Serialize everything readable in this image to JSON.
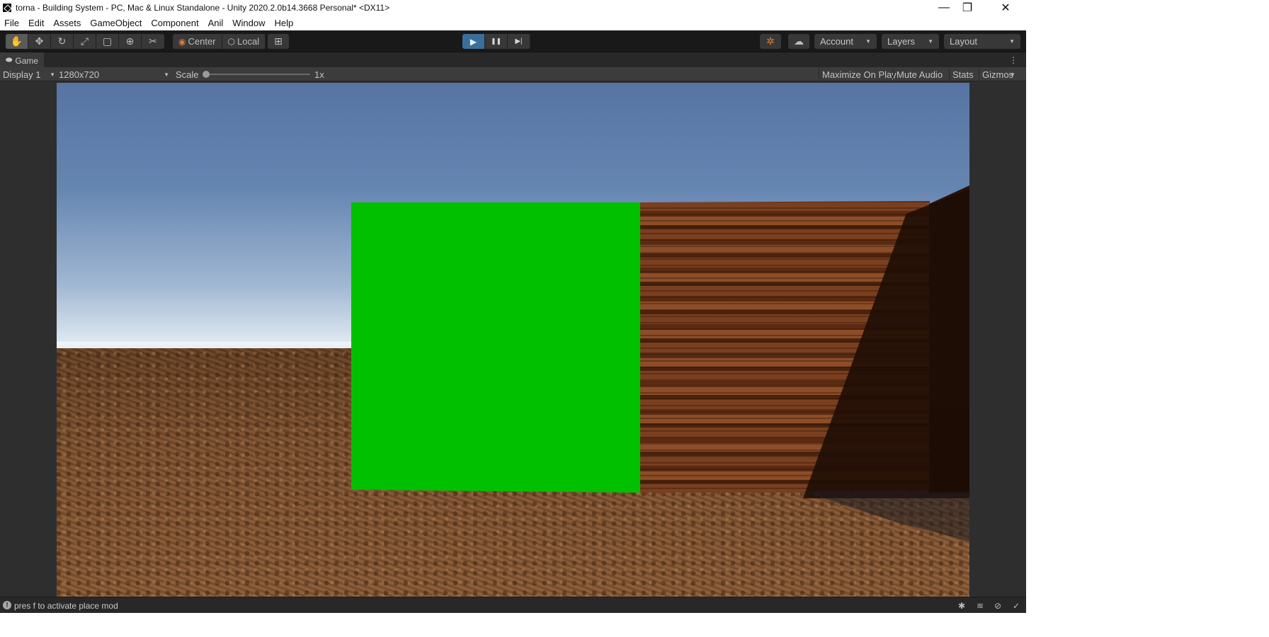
{
  "window": {
    "title": "torna - Building System - PC, Mac & Linux Standalone - Unity 2020.2.0b14.3668 Personal* <DX11>",
    "minimize_glyph": "—",
    "maximize_glyph": "❐",
    "close_glyph": "✕"
  },
  "menu": {
    "items": [
      "File",
      "Edit",
      "Assets",
      "GameObject",
      "Component",
      "Anil",
      "Window",
      "Help"
    ]
  },
  "toolbar": {
    "tools": [
      {
        "name": "hand-tool-icon",
        "glyph": "✋"
      },
      {
        "name": "move-tool-icon",
        "glyph": "✥"
      },
      {
        "name": "rotate-tool-icon",
        "glyph": "↻"
      },
      {
        "name": "scale-tool-icon",
        "glyph": "⤢"
      },
      {
        "name": "rect-tool-icon",
        "glyph": "▢"
      },
      {
        "name": "transform-tool-icon",
        "glyph": "⊕"
      },
      {
        "name": "custom-tool-icon",
        "glyph": "✂"
      }
    ],
    "pivot_label": "Center",
    "pivot_glyph": "◉",
    "space_label": "Local",
    "space_glyph": "⬡",
    "snap_glyph": "⊞",
    "play_glyph": "▶",
    "pause_glyph": "❚❚",
    "step_glyph": "▶|",
    "collab_glyph": "✲",
    "cloud_glyph": "☁",
    "account_label": "Account",
    "layers_label": "Layers",
    "layout_label": "Layout",
    "caret": "▼"
  },
  "game_tab": {
    "icon_glyph": "⬬",
    "label": "Game",
    "menu_glyph": "⋮"
  },
  "game_toolbar": {
    "display_label": "Display 1",
    "resolution_label": "1280x720",
    "scale_label": "Scale",
    "scale_value": "1x",
    "scale_level": 1.0,
    "maximize_label": "Maximize On Play",
    "mute_label": "Mute Audio",
    "stats_label": "Stats",
    "gizmos_label": "Gizmos"
  },
  "status": {
    "icon_glyph": "!",
    "message": "pres f to activate place mod",
    "icons": {
      "bug": "✱",
      "stack": "≋",
      "network": "⊘",
      "check": "✓"
    }
  },
  "colors": {
    "play_active": "#3a6f9b",
    "placement_block": "#00c000",
    "toolbar_bg": "#191919"
  }
}
